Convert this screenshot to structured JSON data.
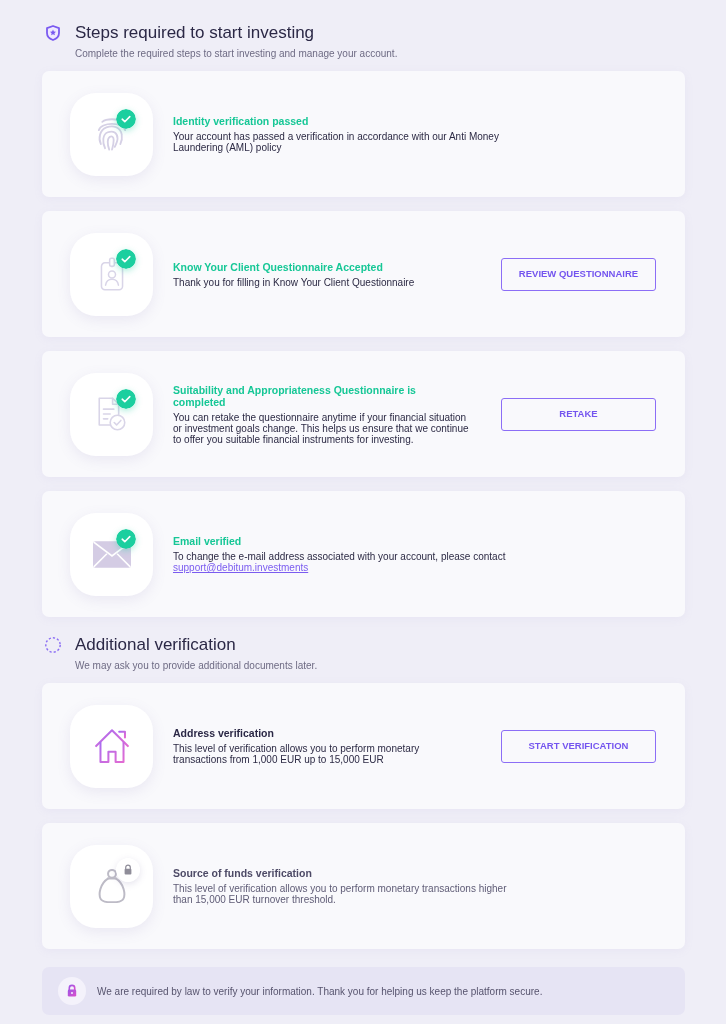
{
  "sections": [
    {
      "kind": "required",
      "title": "Steps required to start investing",
      "subtitle": "Complete the required steps to start investing and manage your account.",
      "steps": [
        {
          "kind": "fingerprint",
          "verified": true,
          "locked": false,
          "title": "Identity verification passed",
          "description": "Your account has passed a verification in accordance with our Anti Money Laundering (AML) policy"
        },
        {
          "kind": "id-badge",
          "verified": true,
          "locked": false,
          "title": "Know Your Client Questionnaire Accepted",
          "description": "Thank you for filling in Know Your Client Questionnaire",
          "button": "REVIEW QUESTIONNAIRE"
        },
        {
          "kind": "document",
          "verified": true,
          "locked": false,
          "title": "Suitability and Appropriateness Questionnaire is completed",
          "description": "You can retake the questionnaire anytime if your financial situation or investment goals change. This helps us ensure that we continue to offer you suitable financial instruments for investing.",
          "button": "RETAKE"
        },
        {
          "kind": "envelope",
          "verified": true,
          "locked": false,
          "title": "Email verified",
          "description": "To change the e-mail address associated with your account, please contact",
          "link": "support@debitum.investments"
        }
      ]
    },
    {
      "kind": "optional",
      "title": "Additional verification",
      "subtitle": "We may ask you to provide additional documents later.",
      "steps": [
        {
          "kind": "house",
          "verified": false,
          "locked": false,
          "title": "Address verification",
          "description": "This level of verification allows you to perform monetary transactions from 1,000 EUR up to 15,000 EUR",
          "button": "START VERIFICATION"
        },
        {
          "kind": "bag",
          "verified": false,
          "locked": true,
          "title": "Source of funds verification",
          "description": "This level of verification allows you to perform monetary transactions higher than 15,000 EUR turnover threshold."
        }
      ]
    }
  ],
  "notice": {
    "text": "We are required by law to verify your information. Thank you for helping us keep the platform secure."
  }
}
